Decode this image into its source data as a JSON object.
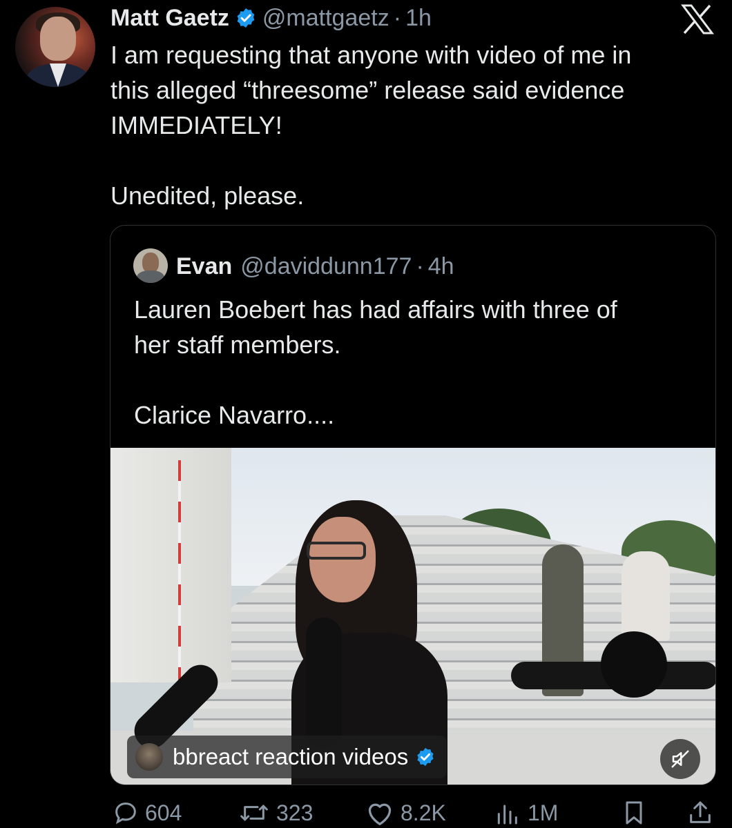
{
  "tweet": {
    "author_name": "Matt Gaetz",
    "handle": "@mattgaetz",
    "separator": "·",
    "time": "1h",
    "text": "I am requesting that anyone with video of me in\nthis alleged “threesome” release said evidence\nIMMEDIATELY!\n\nUnedited, please."
  },
  "quoted": {
    "author_name": "Evan",
    "handle": "@daviddunn177",
    "separator": "·",
    "time": "4h",
    "text": "Lauren Boebert has had affairs with three of\nher staff members.\n\nClarice Navarro....",
    "media_overlay": {
      "channel_name": "bbreact reaction videos"
    }
  },
  "actions": {
    "replies": "604",
    "reposts": "323",
    "likes": "8.2K",
    "views": "1M"
  },
  "icons": {
    "brand": "x-logo-icon",
    "verified": "verified-badge-icon",
    "reply": "reply-icon",
    "repost": "repost-icon",
    "like": "heart-icon",
    "views": "views-icon",
    "bookmark": "bookmark-icon",
    "share": "share-icon",
    "mute": "muted-speaker-icon"
  },
  "colors": {
    "background": "#000000",
    "text": "#e7e9ea",
    "secondary": "#8b98a5",
    "verified": "#1d9bf0"
  }
}
